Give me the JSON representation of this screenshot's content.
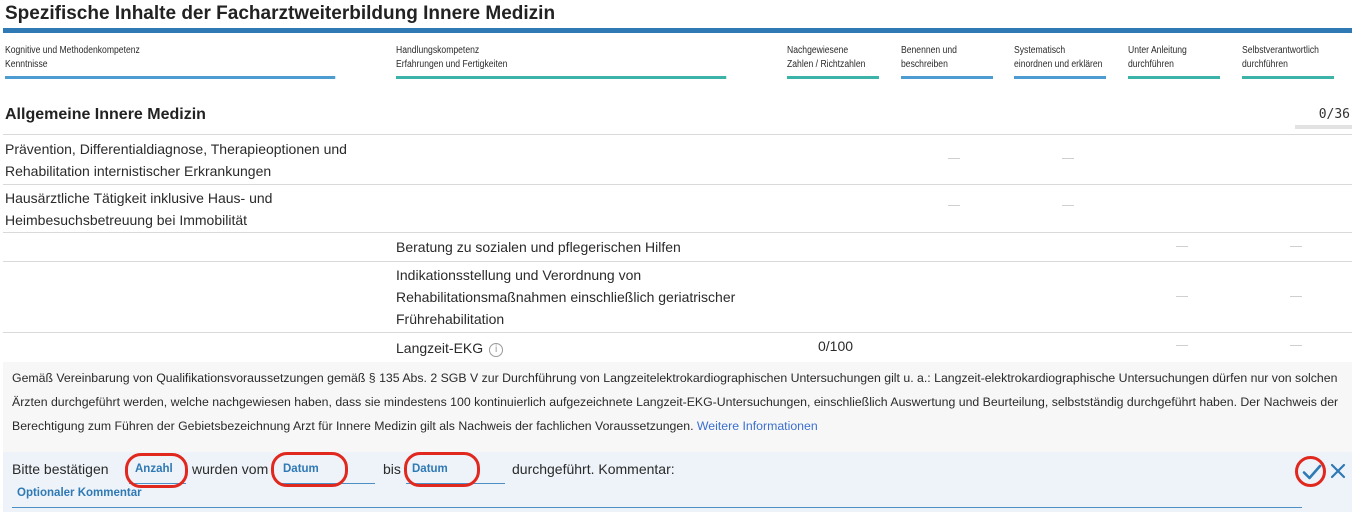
{
  "page": {
    "title": "Spezifische Inhalte der Facharztweiterbildung Innere Medizin"
  },
  "columns": [
    {
      "line1": "Kognitive und Methodenkompetenz",
      "line2": "Kenntnisse",
      "underline": "#2f79b5"
    },
    {
      "line1": "Handlungskompetenz",
      "line2": "Erfahrungen und Fertigkeiten",
      "underline": "#3bb3a8"
    },
    {
      "line1": "Nachgewiesene",
      "line2": "Zahlen / Richtzahlen",
      "underline": "#3bb3a8"
    },
    {
      "line1": "Benennen und",
      "line2": "beschreiben",
      "underline": "#4c9cd2"
    },
    {
      "line1": "Systematisch",
      "line2": "einordnen und erklären",
      "underline": "#4c9cd2"
    },
    {
      "line1": "Unter Anleitung",
      "line2": "durchführen",
      "underline": "#3bb3a8"
    },
    {
      "line1": "Selbstverantwortlich",
      "line2": "durchführen",
      "underline": "#3bb3a8"
    }
  ],
  "section": {
    "title": "Allgemeine Innere Medizin",
    "progress_label": "0/36",
    "progress_fraction": 0
  },
  "rows": [
    {
      "knowledge": "Prävention, Differentialdiagnose, Therapieoptionen und Rehabilitation internistischer Erkrankungen"
    },
    {
      "knowledge": "Hausärztliche Tätigkeit inklusive Haus- und Heimbesuchsbetreuung bei Immobilität"
    },
    {
      "skill": "Beratung zu sozialen und pflegerischen Hilfen"
    },
    {
      "skill": "Indikationsstellung und Verordnung von Rehabilitationsmaßnahmen einschließlich geriatrischer Frührehabilitation"
    },
    {
      "skill": "Langzeit-EKG",
      "info_icon": "info-circle-icon",
      "count": "0/100"
    }
  ],
  "note": {
    "text": "Gemäß Vereinbarung von Qualifikationsvoraussetzungen gemäß § 135 Abs. 2 SGB V zur Durchführung von Langzeitelektrokardiographischen Untersuchungen gilt u. a.: Langzeit-elektrokardiographische Untersuchungen dürfen nur von solchen Ärzten durchgeführt werden, welche nachgewiesen haben, dass sie mindestens 100 kontinuierlich aufgezeichnete Langzeit-EKG-Untersuchungen, einschließlich Auswertung und Beurteilung, selbstständig durchgeführt haben. Der Nachweis der Berechtigung zum Führen der Gebietsbezeichnung Arzt für Innere Medizin gilt als Nachweis der fachlichen Voraussetzungen.",
    "link": "Weitere Informationen"
  },
  "confirm": {
    "prefix": "Bitte bestätigen",
    "count_placeholder": "Anzahl",
    "middle": "wurden vom",
    "from_placeholder": "Datum",
    "until": "bis",
    "to_placeholder": "Datum",
    "suffix": "durchgeführt. Kommentar:",
    "comment_placeholder": "Optionaler Kommentar",
    "confirm_icon": "checkmark-icon",
    "cancel_icon": "close-icon"
  },
  "colors": {
    "accent": "#2f79b5",
    "teal": "#3bb3a8",
    "highlight": "#e0281f",
    "link": "#3b6fd1"
  }
}
